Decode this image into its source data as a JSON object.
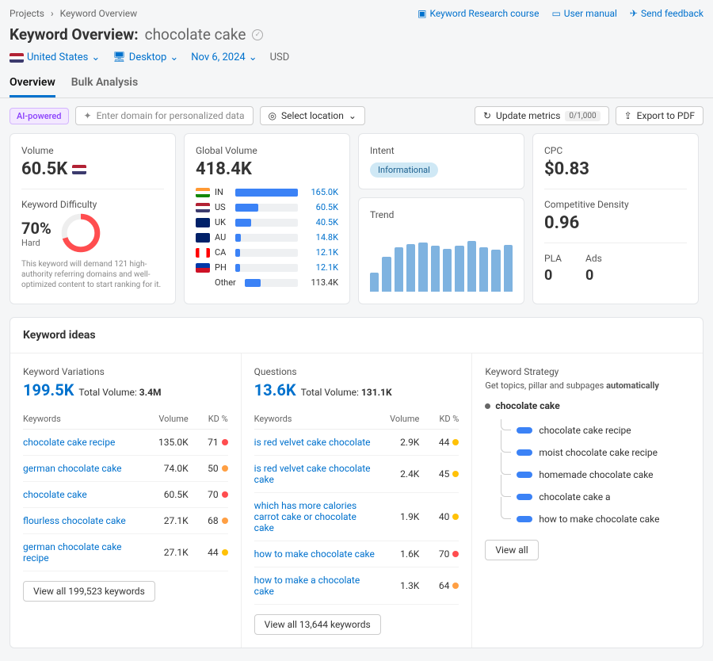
{
  "breadcrumb": {
    "projects": "Projects",
    "current": "Keyword Overview"
  },
  "topLinks": {
    "course": "Keyword Research course",
    "manual": "User manual",
    "feedback": "Send feedback"
  },
  "header": {
    "title": "Keyword Overview:",
    "keyword": "chocolate cake"
  },
  "filters": {
    "country": "United States",
    "device": "Desktop",
    "date": "Nov 6, 2024",
    "currency": "USD"
  },
  "tabs": {
    "overview": "Overview",
    "bulk": "Bulk Analysis"
  },
  "controls": {
    "aiBadge": "AI-powered",
    "domainPlaceholder": "Enter domain for personalized data",
    "locationLabel": "Select location",
    "updateMetrics": "Update metrics",
    "updateCount": "0/1,000",
    "exportPdf": "Export to PDF"
  },
  "volume": {
    "label": "Volume",
    "value": "60.5K"
  },
  "kd": {
    "label": "Keyword Difficulty",
    "value": "70%",
    "level": "Hard",
    "note": "This keyword will demand 121 high-authority referring domains and well-optimized content to start ranking for it."
  },
  "globalVolume": {
    "label": "Global Volume",
    "value": "418.4K",
    "countries": [
      {
        "flag": "in",
        "code": "IN",
        "val": "165.0K",
        "pct": 100
      },
      {
        "flag": "us",
        "code": "US",
        "val": "60.5K",
        "pct": 37
      },
      {
        "flag": "uk",
        "code": "UK",
        "val": "40.5K",
        "pct": 25
      },
      {
        "flag": "au",
        "code": "AU",
        "val": "14.8K",
        "pct": 9
      },
      {
        "flag": "ca",
        "code": "CA",
        "val": "12.1K",
        "pct": 7
      },
      {
        "flag": "ph",
        "code": "PH",
        "val": "12.1K",
        "pct": 7
      }
    ],
    "otherLabel": "Other",
    "otherVal": "113.4K",
    "otherPct": 30
  },
  "intent": {
    "label": "Intent",
    "badge": "Informational"
  },
  "trend": {
    "label": "Trend"
  },
  "chart_data": {
    "type": "bar",
    "title": "Trend",
    "categories": [
      "1",
      "2",
      "3",
      "4",
      "5",
      "6",
      "7",
      "8",
      "9",
      "10",
      "11",
      "12"
    ],
    "values": [
      30,
      55,
      70,
      75,
      78,
      72,
      68,
      72,
      80,
      70,
      66,
      74
    ],
    "ylim": [
      0,
      100
    ]
  },
  "cpc": {
    "label": "CPC",
    "value": "$0.83"
  },
  "density": {
    "label": "Competitive Density",
    "value": "0.96"
  },
  "pla": {
    "label": "PLA",
    "value": "0"
  },
  "ads": {
    "label": "Ads",
    "value": "0"
  },
  "ideas": {
    "title": "Keyword ideas",
    "variations": {
      "label": "Keyword Variations",
      "value": "199.5K",
      "totalLabel": "Total Volume:",
      "totalValue": "3.4M",
      "headKeywords": "Keywords",
      "headVolume": "Volume",
      "headKD": "KD %",
      "rows": [
        {
          "kw": "chocolate cake recipe",
          "vol": "135.0K",
          "kd": "71",
          "color": "red"
        },
        {
          "kw": "german chocolate cake",
          "vol": "74.0K",
          "kd": "50",
          "color": "orange"
        },
        {
          "kw": "chocolate cake",
          "vol": "60.5K",
          "kd": "70",
          "color": "red"
        },
        {
          "kw": "flourless chocolate cake",
          "vol": "27.1K",
          "kd": "68",
          "color": "orange"
        },
        {
          "kw": "german chocolate cake recipe",
          "vol": "27.1K",
          "kd": "44",
          "color": "yellow"
        }
      ],
      "viewAll": "View all 199,523 keywords"
    },
    "questions": {
      "label": "Questions",
      "value": "13.6K",
      "totalLabel": "Total Volume:",
      "totalValue": "131.1K",
      "headKeywords": "Keywords",
      "headVolume": "Volume",
      "headKD": "KD %",
      "rows": [
        {
          "kw": "is red velvet cake chocolate",
          "vol": "2.9K",
          "kd": "44",
          "color": "yellow"
        },
        {
          "kw": "is red velvet cake chocolate cake",
          "vol": "2.4K",
          "kd": "45",
          "color": "yellow"
        },
        {
          "kw": "which has more calories carrot cake or chocolate cake",
          "vol": "1.9K",
          "kd": "40",
          "color": "yellow"
        },
        {
          "kw": "how to make chocolate cake",
          "vol": "1.6K",
          "kd": "70",
          "color": "red"
        },
        {
          "kw": "how to make a chocolate cake",
          "vol": "1.3K",
          "kd": "64",
          "color": "orange"
        }
      ],
      "viewAll": "View all 13,644 keywords"
    },
    "strategy": {
      "label": "Keyword Strategy",
      "subtext1": "Get topics, pillar and subpages",
      "subtext2": "automatically",
      "root": "chocolate cake",
      "items": [
        "chocolate cake recipe",
        "moist chocolate cake recipe",
        "homemade chocolate cake",
        "chocolate cake a",
        "how to make chocolate cake"
      ],
      "viewAll": "View all"
    }
  }
}
